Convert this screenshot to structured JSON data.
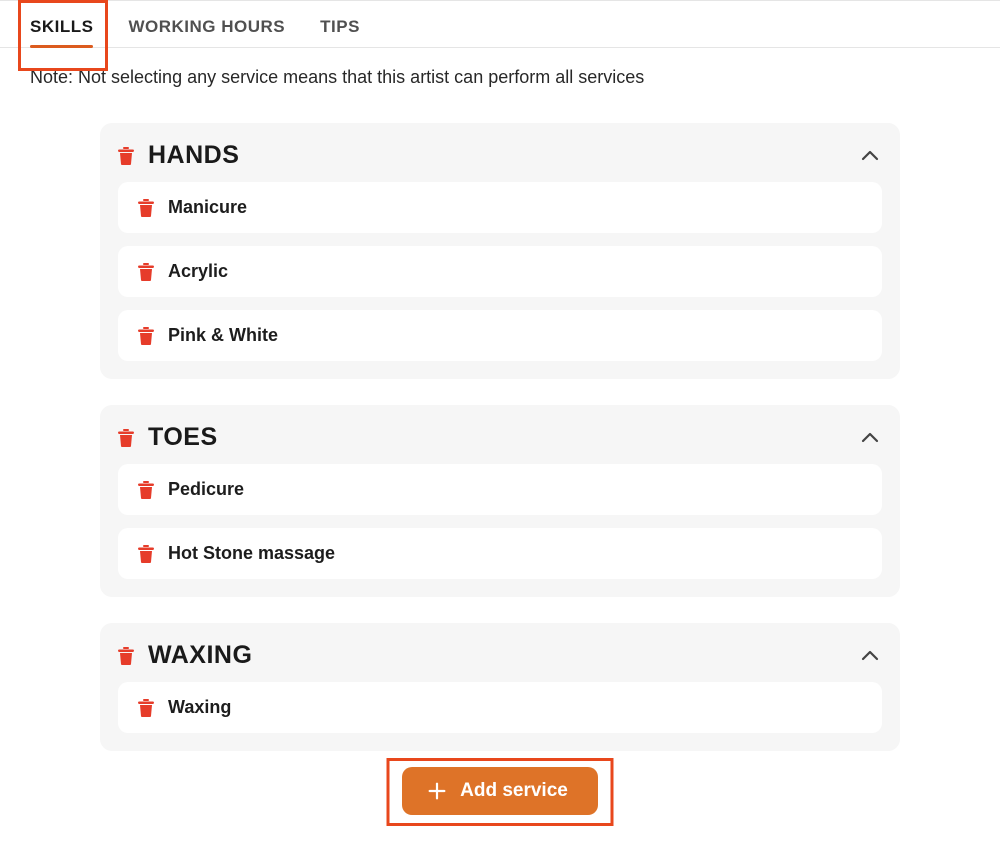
{
  "tabs": {
    "items": [
      {
        "label": "SKILLS",
        "active": true
      },
      {
        "label": "WORKING HOURS",
        "active": false
      },
      {
        "label": "TIPS",
        "active": false
      }
    ]
  },
  "note": "Note: Not selecting any service means that this artist can perform all services",
  "categories": [
    {
      "title": "HANDS",
      "services": [
        "Manicure",
        "Acrylic",
        "Pink & White"
      ]
    },
    {
      "title": "TOES",
      "services": [
        "Pedicure",
        "Hot Stone massage"
      ]
    },
    {
      "title": "WAXING",
      "services": [
        "Waxing"
      ]
    }
  ],
  "add_service_label": "Add service",
  "colors": {
    "accent_orange": "#de7328",
    "highlight_red": "#e8471c",
    "trash_red": "#e63c2a"
  }
}
